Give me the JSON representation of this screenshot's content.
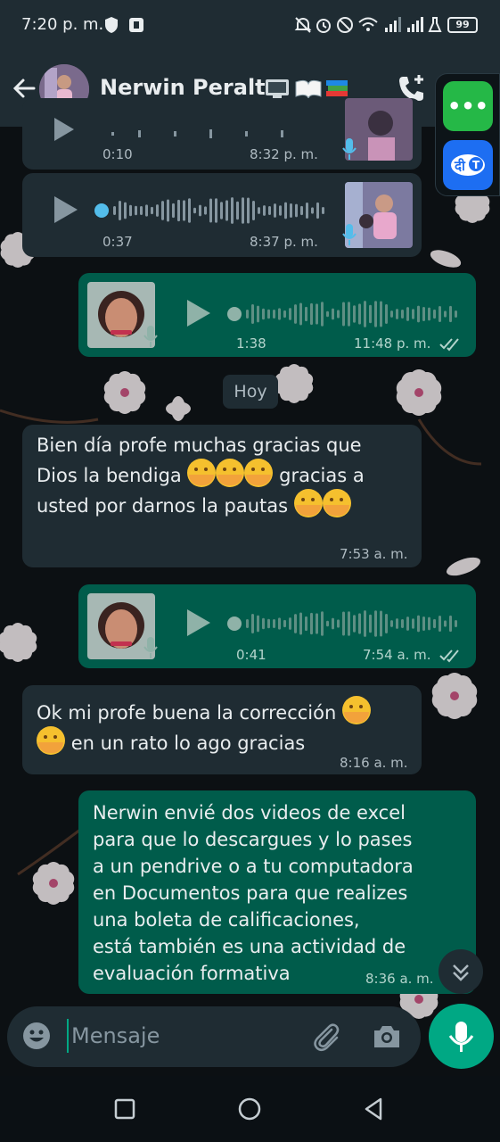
{
  "status_bar": {
    "time": "7:20 p. m.",
    "battery": "99"
  },
  "header": {
    "contact_name": "Nerwin Peralte"
  },
  "messages": [
    {
      "type": "voice",
      "dir": "in",
      "duration": "0:10",
      "time": "8:32 p. m."
    },
    {
      "type": "voice",
      "dir": "in",
      "duration": "0:37",
      "time": "8:37 p. m."
    },
    {
      "type": "voice",
      "dir": "out",
      "duration": "1:38",
      "time": "11:48 p. m."
    },
    {
      "type": "text",
      "dir": "in",
      "text": "Bien día profe muchas gracias que Dios la bendiga 🤗🤗🤗 gracias a usted por darnos la pautas 🤗🤗",
      "time": "7:53 a. m."
    },
    {
      "type": "voice",
      "dir": "out",
      "duration": "0:41",
      "time": "7:54 a. m."
    },
    {
      "type": "text",
      "dir": "in",
      "text": "Ok mi profe buena la corrección 🤗 🤗 en un rato lo ago gracias",
      "time": "8:16 a. m."
    },
    {
      "type": "text",
      "dir": "out",
      "text": "Nerwin envié dos videos de excel para que lo descargues y lo pases a un pendrive o a tu computadora en Documentos para que realizes una boleta de calificaciones, está también es una actividad de evaluación formativa",
      "time": "8:36 a. m."
    }
  ],
  "msg_lines": {
    "m4": [
      "Bien día profe muchas gracias que",
      "Dios la bendiga",
      "gracias a",
      "usted por darnos la pautas"
    ],
    "m6": [
      "Ok mi profe buena la corrección",
      "en un rato lo ago gracias"
    ],
    "m7": [
      "Nerwin envié dos videos de excel",
      "para que lo descargues y lo pases",
      "a un pendrive o a tu computadora",
      "en Documentos para que realizes",
      "una boleta de calificaciones,",
      "está también es una actividad de",
      "evaluación formativa"
    ]
  },
  "day_separator": "Hoy",
  "input": {
    "placeholder": "Mensaje"
  },
  "side_panel": {
    "chat_app_label": "•••",
    "translate_label": "दी T"
  },
  "colors": {
    "header": "#1f2c33",
    "incoming": "#1f2c33",
    "outgoing": "#005c4b",
    "accent": "#00a884"
  },
  "icons": [
    "back-arrow-icon",
    "add-call-icon",
    "play-icon",
    "mic-badge-icon",
    "double-check-icon",
    "emoji-icon",
    "attach-icon",
    "camera-icon",
    "mic-icon",
    "scroll-down-icon",
    "nav-recents-icon",
    "nav-home-icon",
    "nav-back-icon"
  ]
}
